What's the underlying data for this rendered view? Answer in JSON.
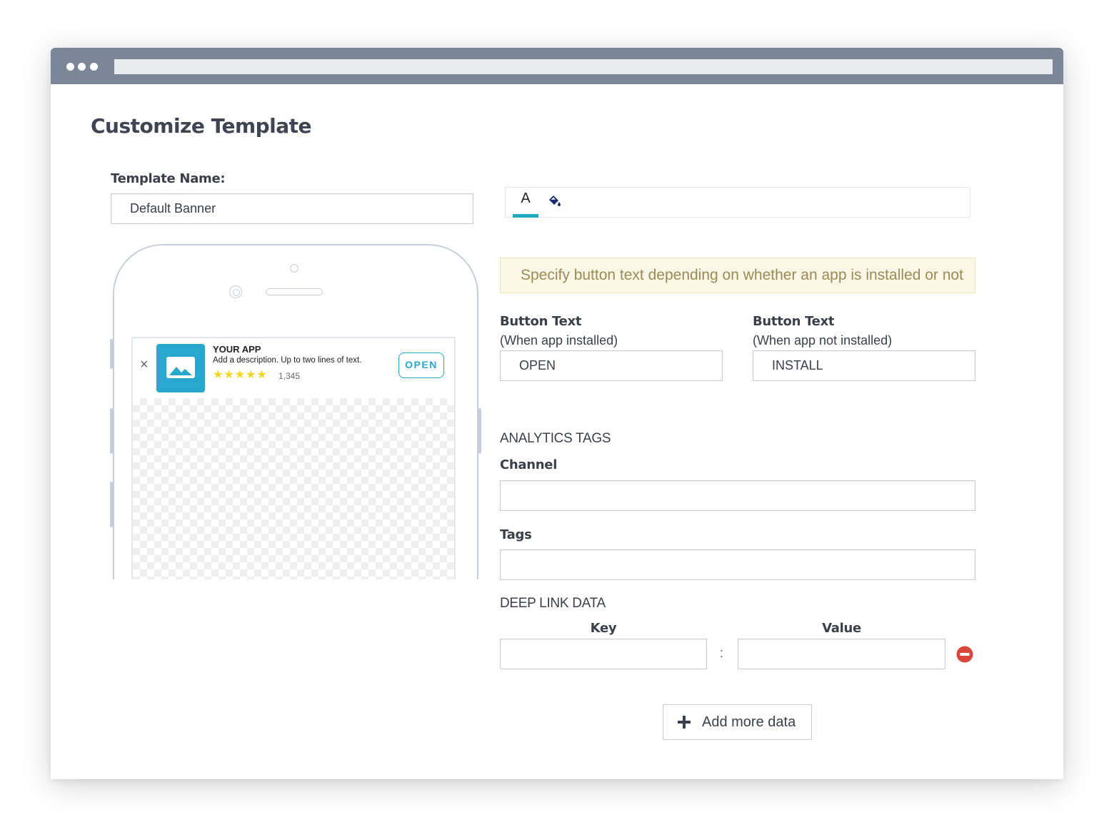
{
  "page": {
    "title": "Customize Template"
  },
  "template_name": {
    "label": "Template Name:",
    "value": "Default Banner"
  },
  "editor_tabs": {
    "text_tab": "A",
    "text_tab_icon": "text-format-icon",
    "fill_tab_icon": "paint-bucket-icon",
    "accent_color": "#1fa9c9"
  },
  "notice": {
    "text": "Specify button text depending on whether an app is installed or not"
  },
  "button_text_installed": {
    "label": "Button Text",
    "sublabel": "(When app installed)",
    "value": "OPEN"
  },
  "button_text_not_installed": {
    "label": "Button Text",
    "sublabel": "(When app not installed)",
    "value": "INSTALL"
  },
  "analytics": {
    "heading": "ANALYTICS TAGS",
    "channel_label": "Channel",
    "channel_value": "",
    "tags_label": "Tags",
    "tags_value": ""
  },
  "deep_link": {
    "heading": "DEEP LINK DATA",
    "key_label": "Key",
    "value_label": "Value",
    "separator": ":",
    "rows": [
      {
        "key": "",
        "value": ""
      }
    ],
    "remove_icon": "remove-circle-icon",
    "add_more_label": "Add more data",
    "add_icon": "plus-icon"
  },
  "preview": {
    "close_glyph": "×",
    "app_name": "YOUR APP",
    "description": "Add a description. Up to two lines of text.",
    "stars": "★★★★★",
    "rating_count": "1,345",
    "open_label": "OPEN",
    "icon": "image-placeholder-icon",
    "brand_color": "#29a8cf",
    "star_color": "#f2d61b"
  }
}
